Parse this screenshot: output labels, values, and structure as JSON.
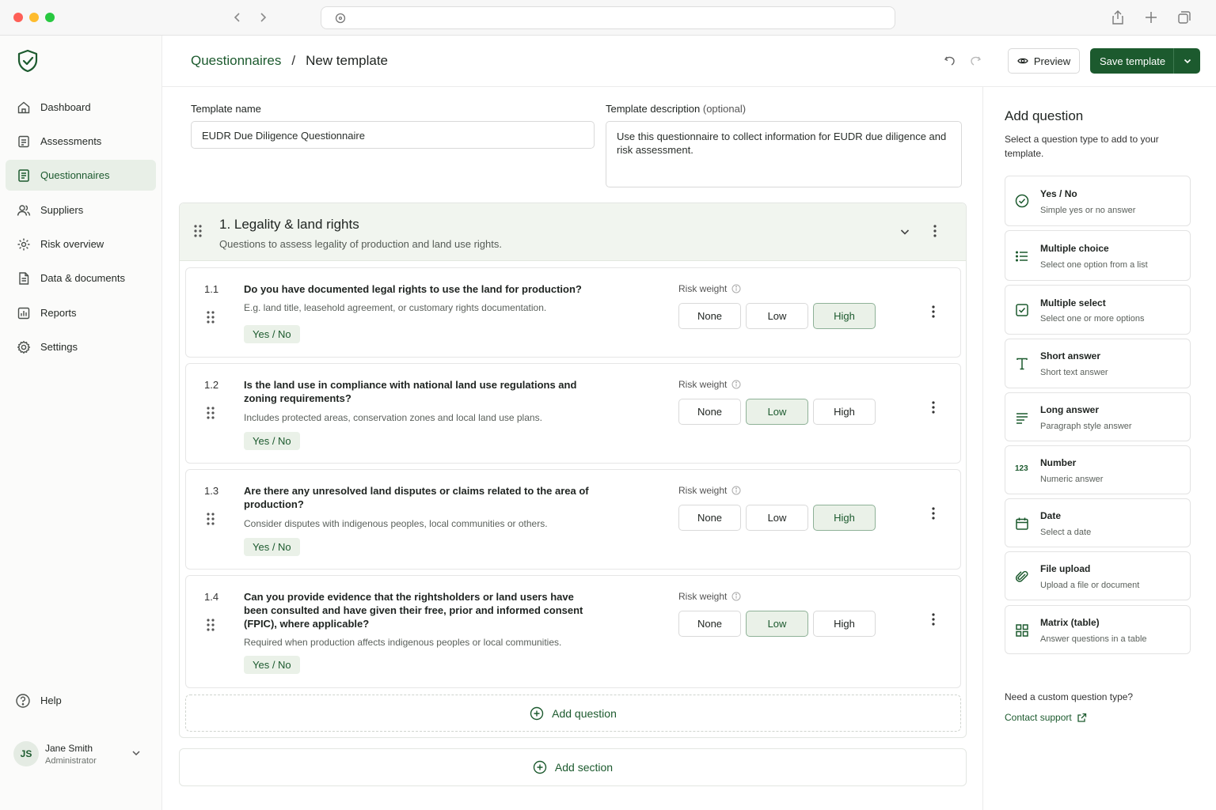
{
  "sidebar": {
    "items": [
      {
        "label": "Dashboard",
        "icon": "home-icon"
      },
      {
        "label": "Assessments",
        "icon": "clipboard-icon"
      },
      {
        "label": "Questionnaires",
        "icon": "document-icon",
        "active": true
      },
      {
        "label": "Suppliers",
        "icon": "users-icon"
      },
      {
        "label": "Risk overview",
        "icon": "risk-gear-icon"
      },
      {
        "label": "Data & documents",
        "icon": "file-icon"
      },
      {
        "label": "Reports",
        "icon": "report-icon"
      },
      {
        "label": "Settings",
        "icon": "gear-icon"
      }
    ],
    "help_label": "Help",
    "user": {
      "initials": "JS",
      "name": "Jane Smith",
      "role": "Administrator"
    }
  },
  "header": {
    "breadcrumb_parent": "Questionnaires",
    "breadcrumb_sep": "/",
    "breadcrumb_current": "New template",
    "preview_label": "Preview",
    "save_label": "Save template"
  },
  "form": {
    "name_label": "Template name",
    "name_value": "EUDR Due Diligence Questionnaire",
    "desc_label": "Template description",
    "desc_optional": "(optional)",
    "desc_value": "Use this questionnaire to collect information for EUDR due diligence and risk assessment."
  },
  "section": {
    "title": "1. Legality & land rights",
    "description": "Questions to assess legality of production and land use rights.",
    "risk_weight_label": "Risk weight",
    "weight_options": [
      "None",
      "Low",
      "High"
    ],
    "questions": [
      {
        "number": "1.1",
        "text": "Do you have documented legal rights to use the land for production?",
        "help": "E.g. land title, leasehold agreement, or customary rights documentation.",
        "type": "Yes / No",
        "risk": "High"
      },
      {
        "number": "1.2",
        "text": "Is the land use in compliance with national land use regulations and zoning requirements?",
        "help": "Includes protected areas, conservation zones and local land use plans.",
        "type": "Yes / No",
        "risk": "Low"
      },
      {
        "number": "1.3",
        "text": "Are there any unresolved land disputes or claims related to the area of production?",
        "help": "Consider disputes with indigenous peoples, local communities or others.",
        "type": "Yes / No",
        "risk": "High"
      },
      {
        "number": "1.4",
        "text": "Can you provide evidence that the rightsholders or land users have been consulted and have given their free, prior and informed consent (FPIC), where applicable?",
        "help": "Required when production affects indigenous peoples or local communities.",
        "type": "Yes / No",
        "risk": "Low"
      }
    ],
    "add_question_label": "Add question"
  },
  "add_section_label": "Add section",
  "panel": {
    "title": "Add question",
    "description": "Select a question type to add to your template.",
    "types": [
      {
        "name": "Yes / No",
        "desc": "Simple yes or no answer",
        "icon": "check-circle-icon"
      },
      {
        "name": "Multiple choice",
        "desc": "Select one option from a list",
        "icon": "list-icon"
      },
      {
        "name": "Multiple select",
        "desc": "Select one or more options",
        "icon": "checkbox-icon"
      },
      {
        "name": "Short answer",
        "desc": "Short text answer",
        "icon": "text-icon"
      },
      {
        "name": "Long answer",
        "desc": "Paragraph style answer",
        "icon": "paragraph-icon"
      },
      {
        "name": "Number",
        "desc": "Numeric answer",
        "icon": "number-icon",
        "glyph": "123"
      },
      {
        "name": "Date",
        "desc": "Select a date",
        "icon": "calendar-icon"
      },
      {
        "name": "File upload",
        "desc": "Upload a file or document",
        "icon": "paperclip-icon"
      },
      {
        "name": "Matrix (table)",
        "desc": "Answer questions in a table",
        "icon": "grid-icon"
      }
    ],
    "need_custom": "Need a custom question type?",
    "contact_label": "Contact support"
  },
  "colors": {
    "brand": "#1c5a2e",
    "selected_bg": "#eaf1e8",
    "section_bg": "#f1f5ef"
  }
}
